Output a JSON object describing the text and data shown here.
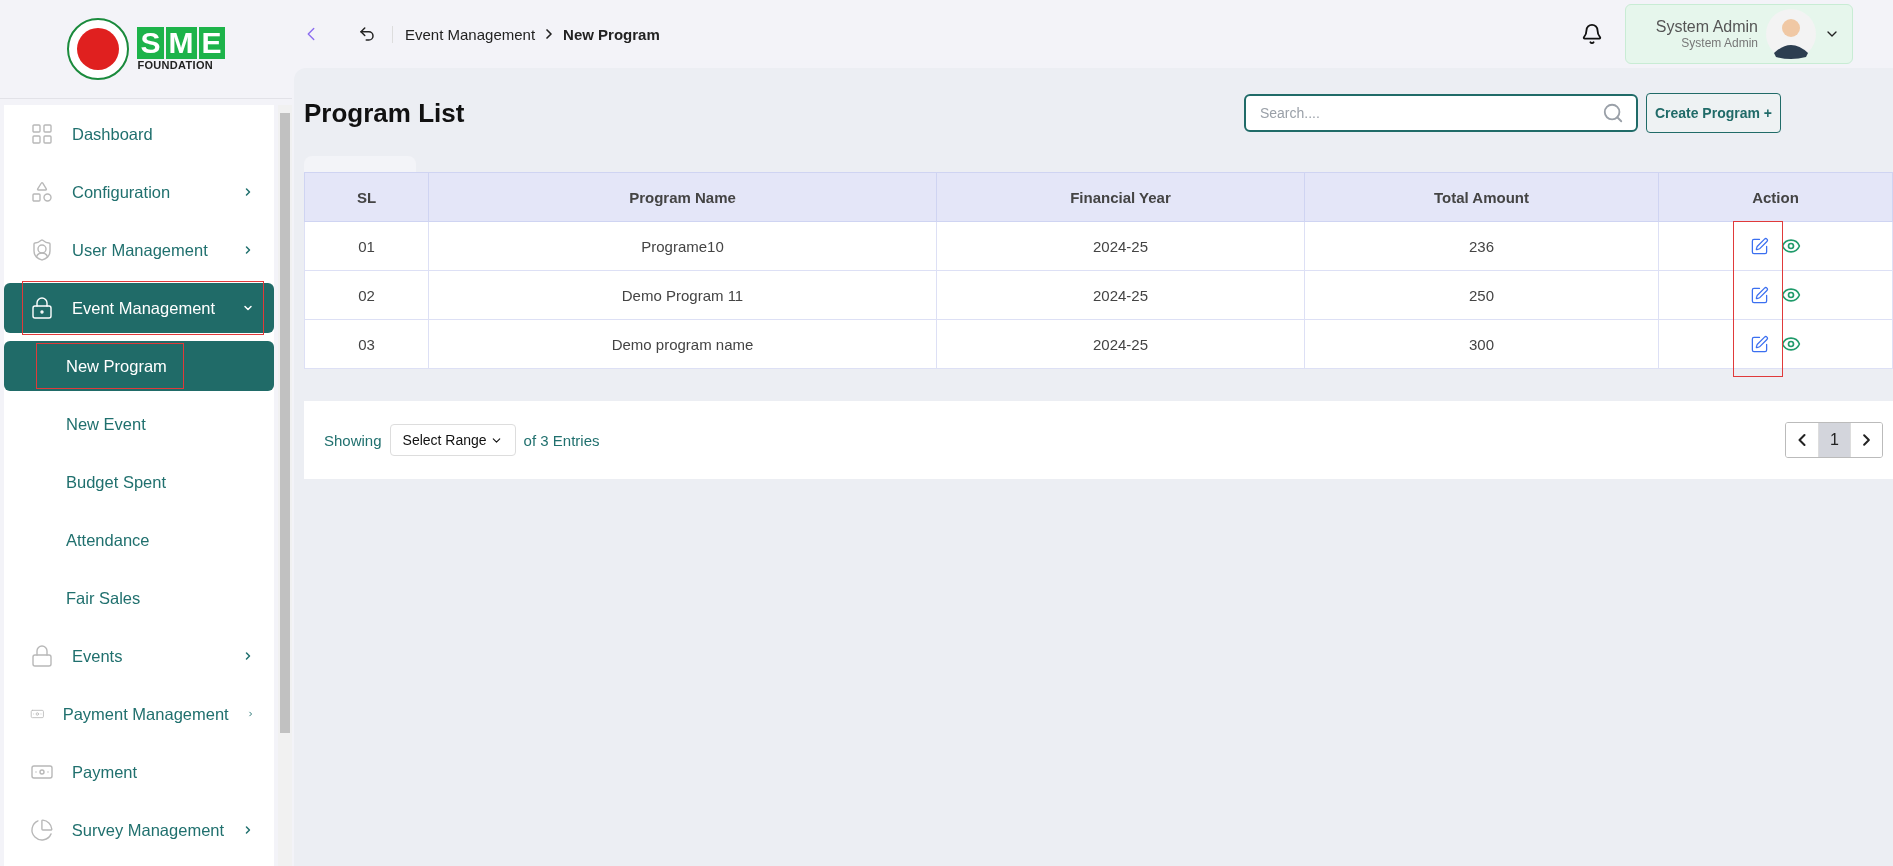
{
  "logo": {
    "letters": "SME",
    "subtitle": "FOUNDATION"
  },
  "breadcrumb": [
    "Event Management",
    "New Program"
  ],
  "user": {
    "name": "System Admin",
    "role": "System Admin"
  },
  "sidebar": {
    "items": [
      {
        "label": "Dashboard",
        "selected": false,
        "highlighted": false
      },
      {
        "label": "Configuration",
        "expanded": false,
        "selected": false,
        "highlighted": false
      },
      {
        "label": "User Management",
        "expanded": false,
        "selected": false,
        "highlighted": false
      },
      {
        "label": "Event Management",
        "expanded": true,
        "selected": true,
        "highlighted": true,
        "children": [
          {
            "label": "New Program",
            "selected": true,
            "highlighted": true
          },
          {
            "label": "New Event",
            "selected": false,
            "highlighted": false
          },
          {
            "label": "Budget Spent",
            "selected": false,
            "highlighted": false
          },
          {
            "label": "Attendance",
            "selected": false,
            "highlighted": false
          },
          {
            "label": "Fair Sales",
            "selected": false,
            "highlighted": false
          }
        ]
      },
      {
        "label": "Events",
        "expanded": false,
        "selected": false,
        "highlighted": false
      },
      {
        "label": "Payment Management",
        "expanded": false,
        "selected": false,
        "highlighted": false
      },
      {
        "label": "Payment",
        "selected": false,
        "highlighted": false
      },
      {
        "label": "Survey Management",
        "expanded": false,
        "selected": false,
        "highlighted": false
      }
    ]
  },
  "page_title": "Program List",
  "search": {
    "placeholder": "Search...."
  },
  "create_button": "Create Program +",
  "table": {
    "columns": [
      "SL",
      "Program Name",
      "Financial Year",
      "Total Amount",
      "Action"
    ],
    "rows": [
      {
        "cells": [
          "01",
          "Programe10",
          "2024-25",
          "236"
        ]
      },
      {
        "cells": [
          "02",
          "Demo Program 11",
          "2024-25",
          "250"
        ]
      },
      {
        "cells": [
          "03",
          "Demo program name",
          "2024-25",
          "300"
        ]
      }
    ],
    "edit_icons_highlighted": true
  },
  "footer": {
    "showing": "Showing",
    "range_select": "Select Range",
    "entries": "of 3 Entries",
    "pages": [
      {
        "label": "1",
        "selected": true
      }
    ]
  }
}
